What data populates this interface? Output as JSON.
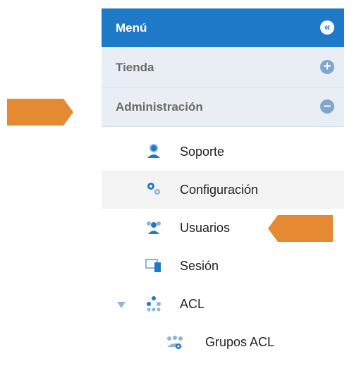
{
  "menu": {
    "title": "Menú",
    "collapse_icon": "double-chevron-left-icon",
    "sections": [
      {
        "label": "Tienda",
        "state_icon": "plus-circle-icon",
        "symbol": "+"
      },
      {
        "label": "Administración",
        "state_icon": "minus-circle-icon",
        "symbol": "–"
      }
    ],
    "items": [
      {
        "label": "Soporte",
        "icon": "support-agent-icon"
      },
      {
        "label": "Configuración",
        "icon": "gears-icon"
      },
      {
        "label": "Usuarios",
        "icon": "users-icon"
      },
      {
        "label": "Sesión",
        "icon": "devices-icon"
      },
      {
        "label": "ACL",
        "icon": "acl-dots-icon"
      },
      {
        "label": "Grupos ACL",
        "icon": "acl-groups-icon"
      }
    ]
  },
  "colors": {
    "header_bg": "#1e79c9",
    "section_bg": "#e8eef4",
    "icon_blue": "#1e79c9",
    "icon_light": "#8cb4de",
    "annotation_arrow": "#e58a33"
  }
}
